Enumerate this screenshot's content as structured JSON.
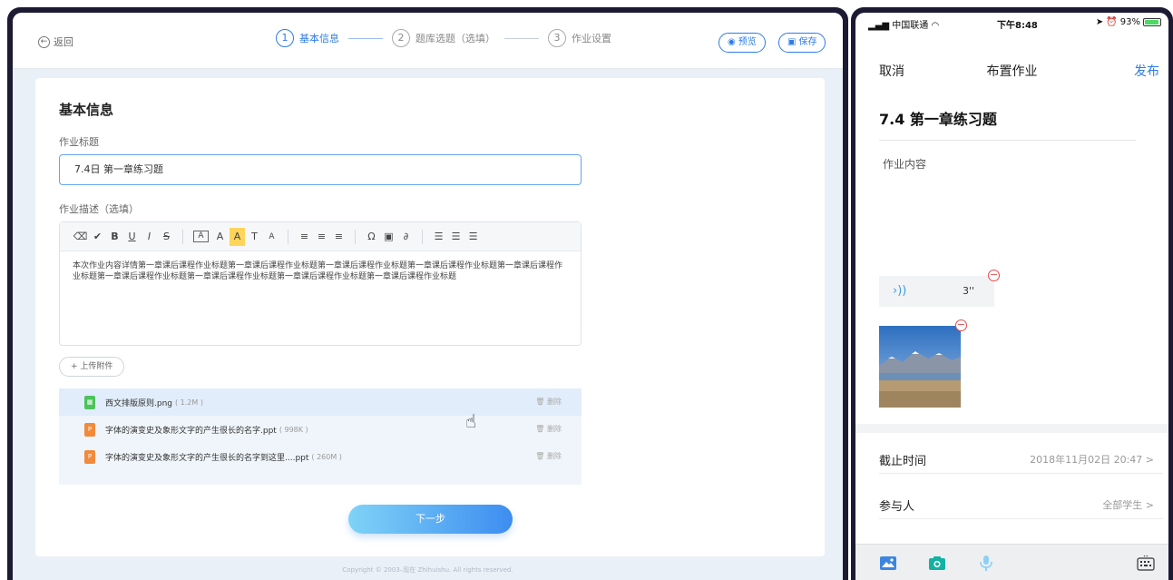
{
  "desktop": {
    "back_label": "返回",
    "steps": [
      {
        "num": "1",
        "label": "基本信息"
      },
      {
        "num": "2",
        "label": "题库选题（选填）"
      },
      {
        "num": "3",
        "label": "作业设置"
      }
    ],
    "preview_label": "预览",
    "save_label": "保存",
    "card_title": "基本信息",
    "title_label": "作业标题",
    "title_value": "7.4日 第一章练习题",
    "desc_label": "作业描述（选填）",
    "toolbar_glyphs": [
      "⌫",
      "✔",
      "B",
      "U",
      "I",
      "S",
      "A",
      "A",
      "A",
      "T",
      "A",
      "≡",
      "≡",
      "≡",
      "Ω",
      "▣",
      "∂",
      "☰",
      "☰",
      "☰"
    ],
    "description": "本次作业内容详情第一章课后课程作业标题第一章课后课程作业标题第一章课后课程作业标题第一章课后课程作业标题第一章课后课程作业标题第一章课后课程作业标题第一章课后课程作业标题第一章课后课程作业标题第一章课后课程作业标题",
    "upload_label": "+ 上传附件",
    "files": [
      {
        "name": "西文排版原则.png",
        "size": "( 1.2M )",
        "type": "png",
        "delete": "删除"
      },
      {
        "name": "字体的演变史及象形文字的产生很长的名字.ppt",
        "size": "( 998K )",
        "type": "ppt",
        "delete": "删除"
      },
      {
        "name": "字体的演变史及象形文字的产生很长的名字到这里....ppt",
        "size": "( 260M )",
        "type": "ppt",
        "delete": "删除"
      }
    ],
    "next_label": "下一步",
    "copyright": "Copyright © 2003–现在 Zhihuishu. All rights reserved."
  },
  "phone": {
    "carrier": "中国联通",
    "time": "下午8:48",
    "battery": "93%",
    "battery_level": 0.93,
    "cancel": "取消",
    "title": "布置作业",
    "publish": "发布",
    "homework_title": "7.4 第一章练习题",
    "content_placeholder": "作业内容",
    "voice_duration": "3''",
    "deadline_label": "截止时间",
    "deadline_value": "2018年11月02日 20:47 >",
    "participants_label": "参与人",
    "participants_value": "全部学生 >",
    "bottom_icons": [
      "image-icon",
      "camera-icon",
      "microphone-icon",
      "keyboard-icon"
    ]
  },
  "colors": {
    "accent": "#2e7be8",
    "frame": "#1d1b33",
    "danger": "#e64c4c",
    "file_png": "#4cc35b",
    "file_ppt": "#f28a3c",
    "camera": "#13b2a2"
  }
}
